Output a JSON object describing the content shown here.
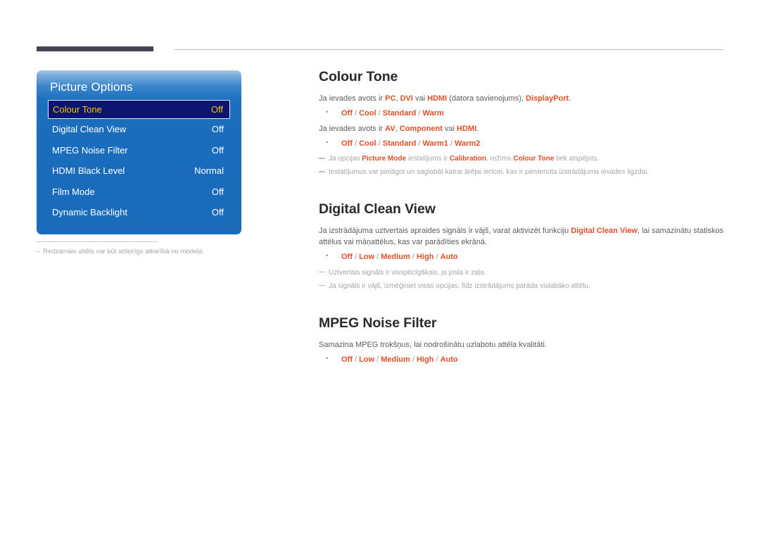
{
  "page": {
    "language": "lv",
    "accent_color": "#df4f28",
    "heading_color": "#2a2a2a",
    "body_color": "#5d5d5d",
    "note_color": "#a5a5a5",
    "panel_blue": "#1a6cbb",
    "selection_fill": "#0b1470",
    "selection_text": "#f5c400",
    "header_bar_color": "#464150"
  },
  "osd": {
    "title": "Picture Options",
    "rows": [
      {
        "label": "Colour Tone",
        "value": "Off",
        "selected": true
      },
      {
        "label": "Digital Clean View",
        "value": "Off",
        "selected": false
      },
      {
        "label": "MPEG Noise Filter",
        "value": "Off",
        "selected": false
      },
      {
        "label": "HDMI Black Level",
        "value": "Normal",
        "selected": false
      },
      {
        "label": "Film Mode",
        "value": "Off",
        "selected": false
      },
      {
        "label": "Dynamic Backlight",
        "value": "Off",
        "selected": false
      }
    ],
    "footnote_dash": "–",
    "footnote": "Redzamais attēls var būt atšķirīgs atkarībā no modeļa."
  },
  "sections": {
    "colour_tone": {
      "heading": "Colour Tone",
      "para1_a": "Ja ievades avots ir ",
      "para1_pc": "PC",
      "para1_c1": ", ",
      "para1_dvi": "DVI",
      "para1_vai": " vai ",
      "para1_hdmi": "HDMI",
      "para1_b": " (datora savienojums), ",
      "para1_dp": "DisplayPort",
      "para1_end": ".",
      "bullet1": {
        "o1": "Off",
        "o2": "Cool",
        "o3": "Standard",
        "o4": "Warm"
      },
      "para2_a": "Ja ievades avots ir ",
      "para2_av": "AV",
      "para2_c1": ", ",
      "para2_comp": "Component",
      "para2_vai": " vai ",
      "para2_hdmi": "HDMI",
      "para2_end": ".",
      "bullet2": {
        "o1": "Off",
        "o2": "Cool",
        "o3": "Standard",
        "o4": "Warm1",
        "o5": "Warm2"
      },
      "note1_a": "Ja opcijas ",
      "note1_pm": "Picture Mode",
      "note1_b": " iestatījums ir ",
      "note1_cal": "Calibration",
      "note1_c": ", režīms ",
      "note1_ct": "Colour Tone",
      "note1_d": " tiek atspējots.",
      "note2": "Iestatījumus var pielāgot un saglabāt katrai ārējai ierīcei, kas ir pievienota izstrādājuma ievades ligzdai."
    },
    "digital_clean_view": {
      "heading": "Digital Clean View",
      "para_a": "Ja izstrādājuma uztvertais apraides signāls ir vājš, varat aktivizēt funkciju ",
      "para_dcv": "Digital Clean View",
      "para_b": ", lai samazinātu statiskos attēlus vai māņattēlus, kas var parādīties ekrānā.",
      "bullet": {
        "o1": "Off",
        "o2": "Low",
        "o3": "Medium",
        "o4": "High",
        "o5": "Auto"
      },
      "note1": "Uztvertais signāls ir visspēcīgākais, ja josla ir zaļa.",
      "note2": "Ja signāls ir vājš, izmēģiniet visas opcijas, līdz izstrādājums parāda vislabāko attēlu."
    },
    "mpeg_noise_filter": {
      "heading": "MPEG Noise Filter",
      "para": "Samazina MPEG trokšņus, lai nodrošinātu uzlabotu attēla kvalitāti.",
      "bullet": {
        "o1": "Off",
        "o2": "Low",
        "o3": "Medium",
        "o4": "High",
        "o5": "Auto"
      }
    }
  },
  "separators": {
    "slash": " / "
  }
}
